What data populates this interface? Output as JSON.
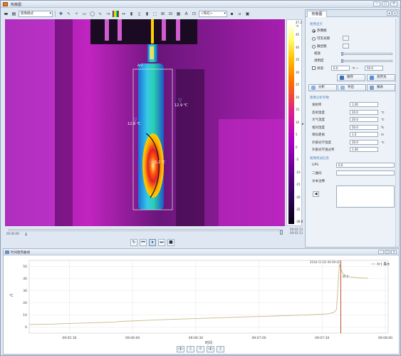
{
  "window": {
    "title": "热像图"
  },
  "toolbar": {
    "mode_select": "图像模式",
    "palette_select": "<铁虹>"
  },
  "thermal": {
    "roi_label": "Ar1",
    "spots": [
      {
        "label": "12.9 ℃"
      },
      {
        "label": "12.9 ℃"
      },
      {
        "label": "5.2 ℃"
      }
    ]
  },
  "scale": {
    "top_value": "47.2 ℃",
    "labels": [
      "45",
      "40",
      "35",
      "30",
      "25",
      "20",
      "15",
      "10",
      "5",
      "0",
      "-5",
      "-10",
      "-15",
      "-20",
      "-25"
    ],
    "bottom_value": "-28.8"
  },
  "timeline": {
    "left_time": "00:00:00",
    "right_time_1": "00:02:13",
    "right_time_2": "00:02:13"
  },
  "playback": {
    "buttons": [
      "↻",
      "⏮",
      "⏸",
      "⏭",
      "■"
    ]
  },
  "panel": {
    "tab_label": "热像图",
    "section_display": "图像显示",
    "radio_thermal": "热像图",
    "radio_visible": "可见光图",
    "radio_fusion": "融合图",
    "fusion_ratio_label": "缩放",
    "transparency_label": "透明度",
    "range_check_label": "调温",
    "range_min": "0.0",
    "range_unit": "℃ ~",
    "range_max": "50.0",
    "save_button": "保存",
    "save_as_button": "另存为",
    "analyze_button": "分析",
    "export_button": "导出",
    "report_button": "报表",
    "section_params": "图像分析参数",
    "params": [
      {
        "label": "发射率",
        "value": "1.00",
        "unit": ""
      },
      {
        "label": "反射温度",
        "value": "20.0",
        "unit": "℃"
      },
      {
        "label": "大气温度",
        "value": "20.0",
        "unit": "℃"
      },
      {
        "label": "相对湿度",
        "value": "50.0",
        "unit": "%"
      },
      {
        "label": "目标距离",
        "value": "1.0",
        "unit": "m"
      },
      {
        "label": "外部光学温度",
        "value": "20.0",
        "unit": "℃"
      },
      {
        "label": "外部光学透过率",
        "value": "1.00",
        "unit": ""
      }
    ],
    "section_info": "图像附加信息",
    "info": [
      {
        "label": "GPS",
        "value": "0,0"
      },
      {
        "label": "二维码",
        "value": ""
      },
      {
        "label": "文本注释",
        "value": ""
      }
    ]
  },
  "trend": {
    "title": "时间趋势曲线",
    "legend": "Ar1 最大",
    "cursor_time": "2018-11-02 09:09:42",
    "cursor_value": "40.2",
    "controls": [
      "◁▷",
      "◊",
      "⟐",
      "◁▷",
      "◊"
    ]
  },
  "chart_data": {
    "type": "line",
    "title": "",
    "xlabel": "时间",
    "ylabel": "℃",
    "x_ticks": [
      "09:05:30",
      "09:06:00",
      "09:06:30",
      "09:07:00",
      "09:07:30",
      "09:08:00"
    ],
    "y_ticks": [
      0,
      10,
      20,
      30,
      40,
      50
    ],
    "ylim": [
      -5,
      55
    ],
    "series": [
      {
        "name": "Ar1 最大",
        "color": "#c8b98a",
        "x": [
          0,
          4,
          8,
          12,
          16,
          20,
          24,
          28,
          30,
          31,
          35,
          40,
          45,
          50,
          55,
          60,
          65,
          70,
          75,
          80,
          85,
          90,
          95,
          100,
          104,
          106,
          107,
          108,
          109,
          110,
          112,
          114,
          116,
          118
        ],
        "y": [
          2.1,
          2.3,
          2.5,
          2.8,
          3.1,
          3.4,
          3.7,
          4.0,
          4.2,
          4.6,
          5.0,
          5.5,
          6.0,
          6.4,
          6.8,
          7.2,
          7.6,
          8.0,
          8.4,
          8.7,
          9.1,
          9.5,
          9.9,
          10.4,
          11.0,
          12.0,
          14.5,
          52.0,
          45.0,
          42.5,
          41.3,
          40.8,
          40.5,
          40.2
        ]
      }
    ],
    "cursor_x": 108.5
  }
}
